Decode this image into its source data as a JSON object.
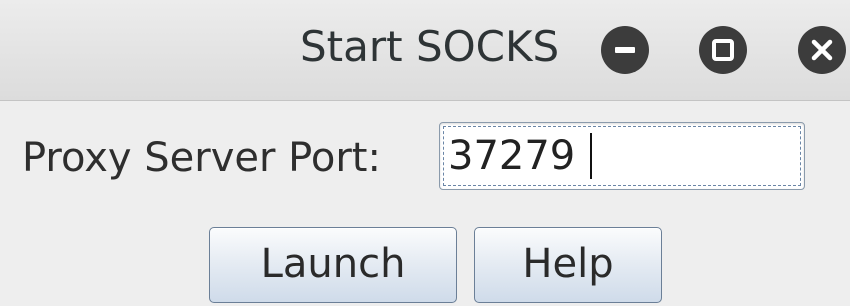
{
  "window": {
    "title": "Start SOCKS",
    "controls": {
      "minimize_icon": "minimize-icon",
      "maximize_icon": "maximize-icon",
      "close_icon": "close-icon"
    }
  },
  "form": {
    "port_label": "Proxy Server Port:",
    "port_value": "37279"
  },
  "buttons": {
    "launch_label": "Launch",
    "help_label": "Help"
  },
  "colors": {
    "titlebar": "#dcdcdc",
    "window_control": "#3c3c3c",
    "button_border": "#6b7f97",
    "focus_ring": "#6a85a6"
  }
}
